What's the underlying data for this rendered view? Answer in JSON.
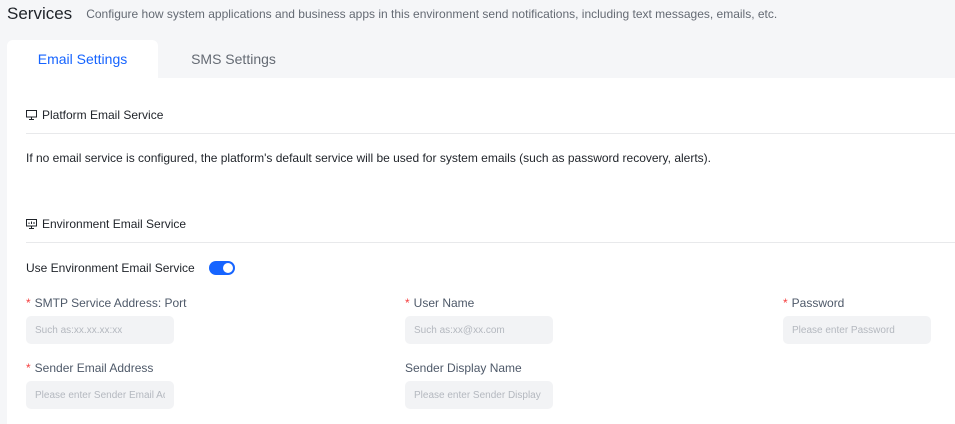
{
  "header": {
    "title": "Services",
    "description": "Configure how system applications and business apps in this environment send notifications, including text messages, emails, etc."
  },
  "tabs": [
    {
      "label": "Email Settings",
      "active": true
    },
    {
      "label": "SMS Settings",
      "active": false
    }
  ],
  "platform_section": {
    "icon": "monitor-icon",
    "title": "Platform Email Service",
    "note": "If no email service is configured, the platform's default service will be used for system emails (such as password recovery, alerts)."
  },
  "environment_section": {
    "icon": "monitor-chart-icon",
    "title": "Environment Email Service",
    "toggle_label": "Use Environment Email Service",
    "toggle_on": true
  },
  "form": {
    "required_mark": "*",
    "smtp": {
      "label": "SMTP Service Address: Port",
      "placeholder": "Such as:xx.xx.xx:xx",
      "value": ""
    },
    "username": {
      "label": "User Name",
      "placeholder": "Such as:xx@xx.com",
      "value": ""
    },
    "password": {
      "label": "Password",
      "placeholder": "Please enter Password",
      "value": ""
    },
    "sender_email": {
      "label": "Sender Email Address",
      "placeholder": "Please enter Sender Email Address",
      "value": ""
    },
    "sender_name": {
      "label": "Sender Display Name",
      "placeholder": "Please enter Sender Display Name",
      "value": ""
    }
  },
  "colors": {
    "accent": "#1664ff",
    "required": "#f53f3f",
    "page_bg": "#f5f6f8"
  }
}
